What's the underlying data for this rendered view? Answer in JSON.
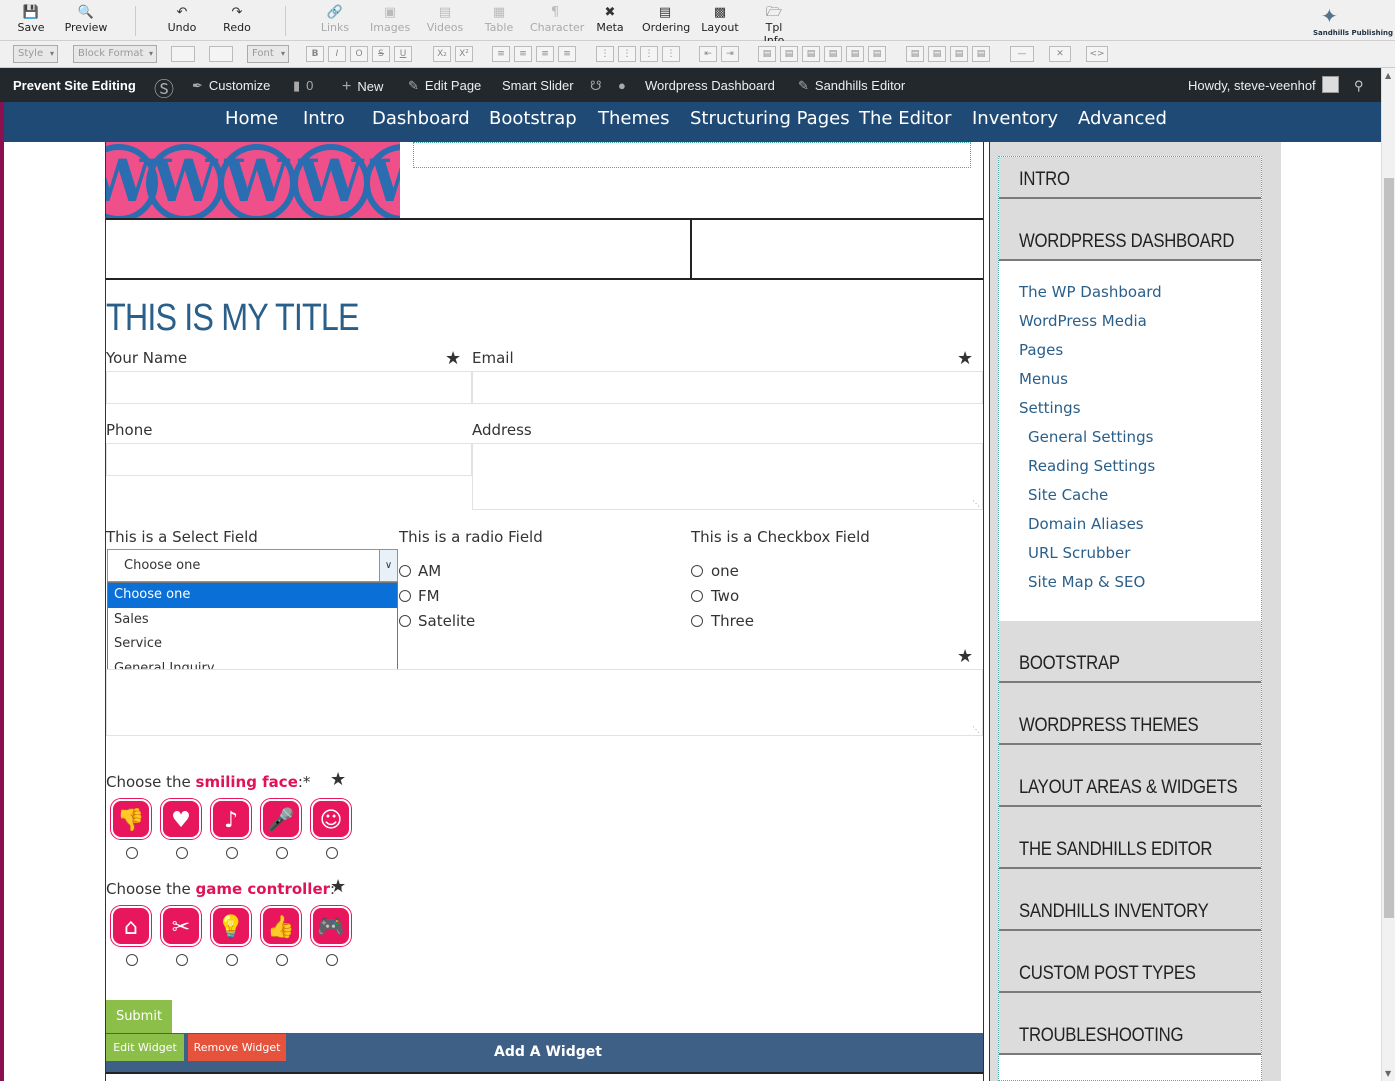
{
  "toolbar": {
    "save": "Save",
    "preview": "Preview",
    "undo": "Undo",
    "redo": "Redo",
    "links": "Links",
    "images": "Images",
    "videos": "Videos",
    "table": "Table",
    "character": "Character",
    "meta": "Meta",
    "ordering": "Ordering",
    "layout": "Layout",
    "tplinfo": "Tpl Info"
  },
  "logo": {
    "text": "Sandhills Publishing"
  },
  "format_bar": {
    "style": "Style",
    "block_format": "Block Format",
    "font": "Font"
  },
  "admin_bar": {
    "prevent": "Prevent Site Editing",
    "customize": "Customize",
    "comments": "0",
    "new": "New",
    "edit_page": "Edit Page",
    "smart_slider": "Smart Slider",
    "dashboard": "Wordpress Dashboard",
    "sandhills_editor": "Sandhills Editor",
    "howdy": "Howdy, steve-veenhof"
  },
  "nav": [
    "Home",
    "Intro",
    "Dashboard",
    "Bootstrap",
    "Themes",
    "Structuring Pages",
    "The Editor",
    "Inventory",
    "Advanced"
  ],
  "page": {
    "title": "THIS IS MY TITLE"
  },
  "form": {
    "name_label": "Your Name",
    "email_label": "Email",
    "phone_label": "Phone",
    "address_label": "Address",
    "select_label": "This is a Select Field",
    "select_value": "Choose one",
    "select_options": [
      "Choose one",
      "Sales",
      "Service",
      "General Inquiry"
    ],
    "radio_label": "This is a radio Field",
    "radio_options": [
      "AM",
      "FM",
      "Satelite"
    ],
    "checkbox_label": "This is a Checkbox Field",
    "checkbox_options": [
      "one",
      "Two",
      "Three"
    ],
    "captcha1_prefix": "Choose the ",
    "captcha1_key": "smiling face",
    "captcha1_suffix": ":*",
    "captcha2_prefix": "Choose the ",
    "captcha2_key": "game controller",
    "captcha2_suffix": ":*",
    "submit": "Submit"
  },
  "captcha_icons_1": [
    "thumbs-down-icon",
    "heart-icon",
    "music-note-icon",
    "microphone-icon",
    "smiley-icon"
  ],
  "captcha_icons_2": [
    "home-icon",
    "scissors-icon",
    "lightbulb-icon",
    "thumbs-up-icon",
    "game-controller-icon"
  ],
  "widget": {
    "edit": "Edit Widget",
    "remove": "Remove Widget",
    "add": "Add A Widget"
  },
  "sidebar": {
    "h_intro": "INTRO",
    "h_dashboard": "WORDPRESS DASHBOARD",
    "links": [
      "The WP Dashboard",
      "WordPress Media",
      "Pages",
      "Menus",
      "Settings"
    ],
    "sublinks": [
      "General Settings",
      "Reading Settings",
      "Site Cache",
      "Domain Aliases",
      "URL Scrubber",
      "Site Map & SEO"
    ],
    "sections": [
      "BOOTSTRAP",
      "WORDPRESS THEMES",
      "LAYOUT AREAS & WIDGETS",
      "THE SANDHILLS EDITOR",
      "SANDHILLS INVENTORY",
      "CUSTOM POST TYPES",
      "TROUBLESHOOTING"
    ]
  },
  "colors": {
    "accent": "#e8175d",
    "nav": "#1f4a75",
    "admin": "#23282d",
    "title": "#2a5f8a",
    "submit": "#8cbf4a"
  }
}
